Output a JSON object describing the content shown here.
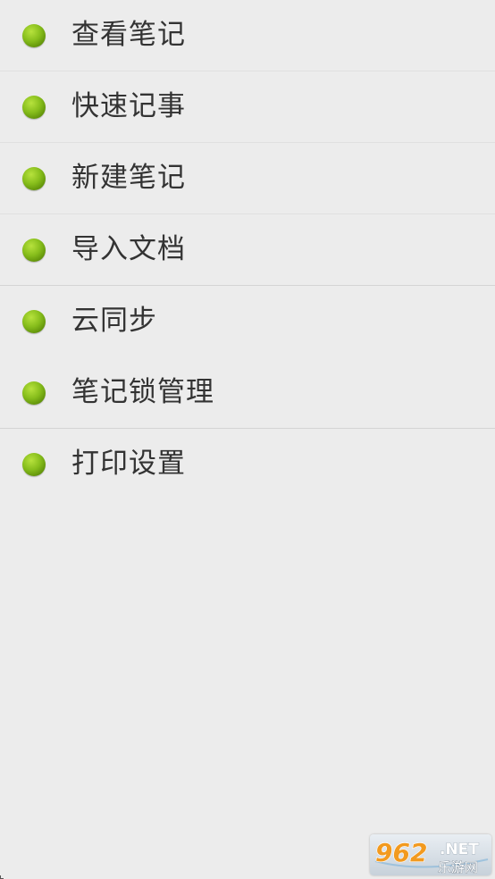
{
  "colors": {
    "background": "#ececec",
    "text": "#333333",
    "bullet": "#86bd1b"
  },
  "menu": {
    "items": [
      {
        "label": "查看笔记",
        "icon": "green-bullet-icon"
      },
      {
        "label": "快速记事",
        "icon": "green-bullet-icon"
      },
      {
        "label": "新建笔记",
        "icon": "green-bullet-icon"
      },
      {
        "label": "导入文档",
        "icon": "green-bullet-icon"
      },
      {
        "label": "云同步",
        "icon": "green-bullet-icon"
      },
      {
        "label": "笔记锁管理",
        "icon": "green-bullet-icon"
      },
      {
        "label": "打印设置",
        "icon": "green-bullet-icon"
      }
    ]
  },
  "watermark": {
    "number": "962",
    "suffix": ".NET",
    "chinese": "乐游网"
  }
}
